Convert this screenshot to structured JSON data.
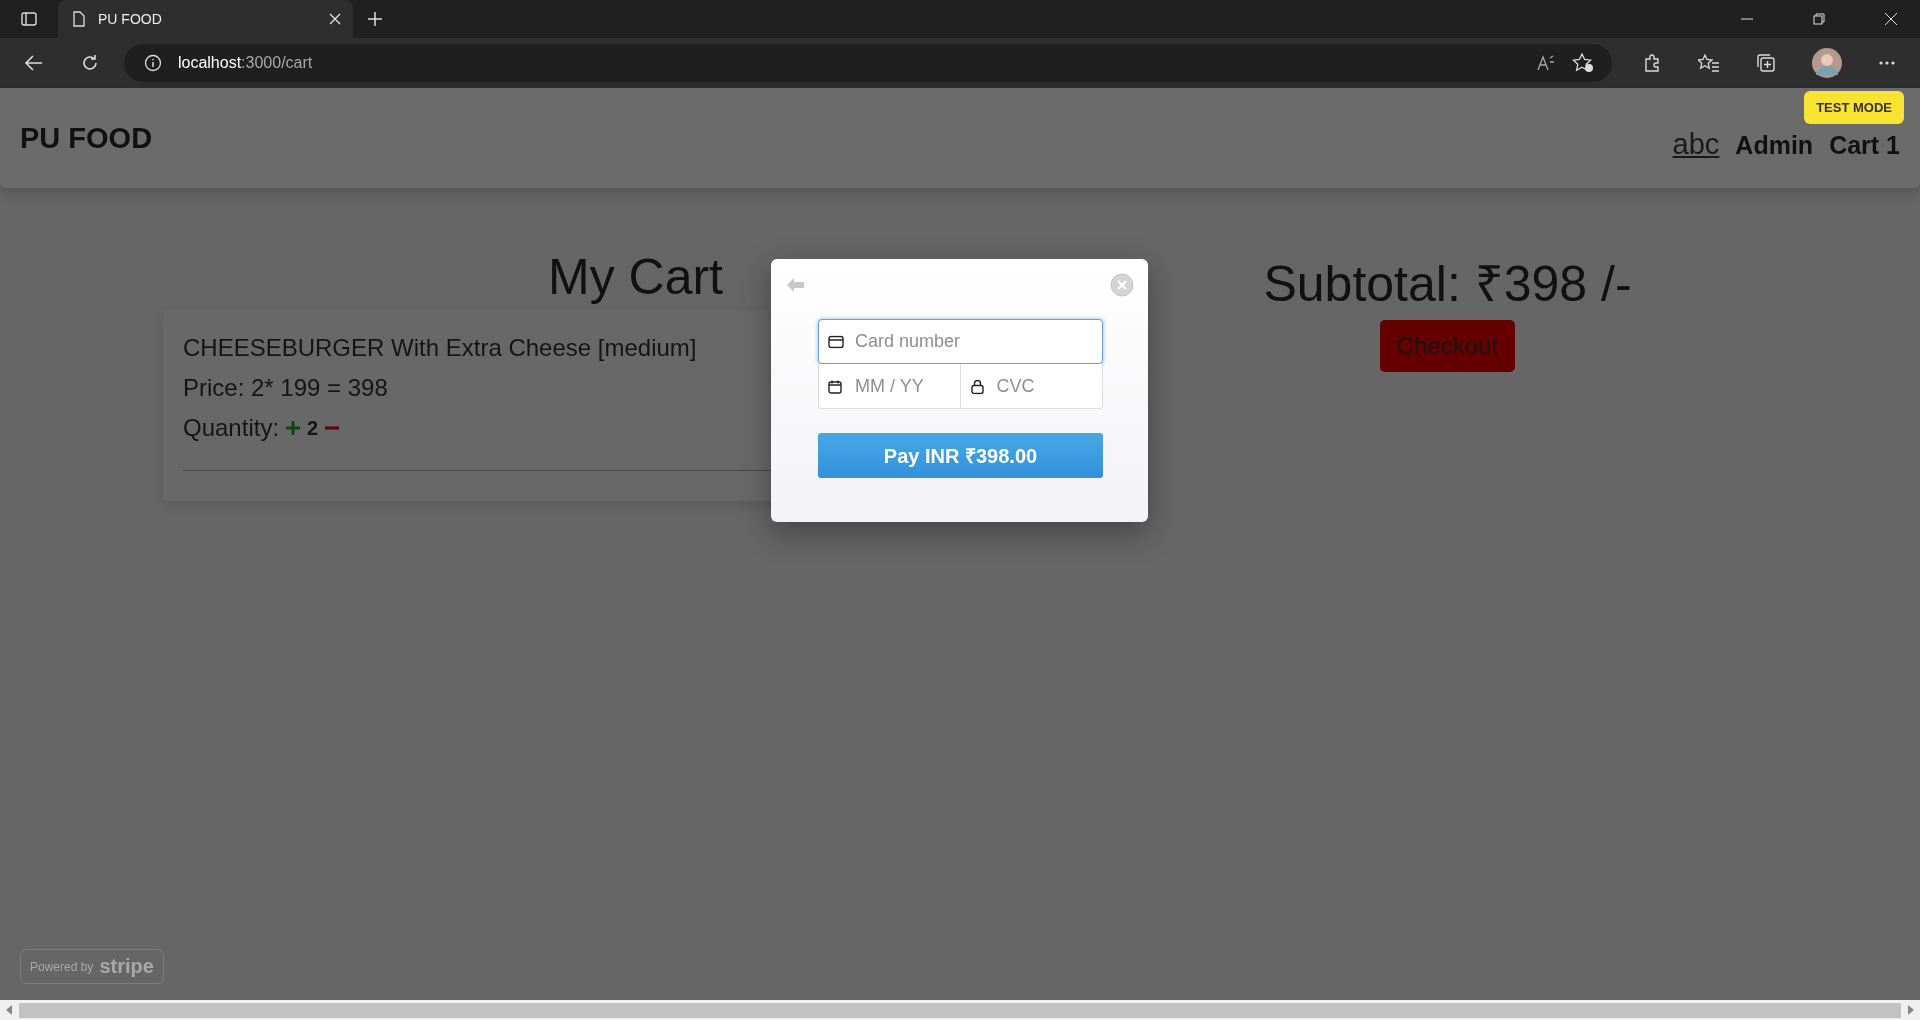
{
  "browser": {
    "tab_title": "PU FOOD",
    "url_host": "localhost",
    "url_path": ":3000/cart"
  },
  "header": {
    "brand": "PU FOOD",
    "nav": [
      {
        "label": "abc",
        "kind": "user"
      },
      {
        "label": "Admin",
        "kind": "link"
      },
      {
        "label": "Cart 1",
        "kind": "link"
      }
    ]
  },
  "cart": {
    "title": "My Cart",
    "items": [
      {
        "name": "CHEESEBURGER With Extra Cheese [medium]",
        "price": "Price: 2* 199 = 398",
        "quantity_label": "Quantity:",
        "quantity": "2"
      }
    ]
  },
  "summary": {
    "subtotal": "Subtotal: ₹398 /-",
    "checkout": "Checkout"
  },
  "payment": {
    "badge": "TEST MODE",
    "card_placeholder": "Card number",
    "expiry_placeholder": "MM / YY",
    "cvc_placeholder": "CVC",
    "pay": "Pay INR ₹398.00"
  },
  "footer": {
    "powered_by": "Powered by",
    "brand": "stripe"
  }
}
